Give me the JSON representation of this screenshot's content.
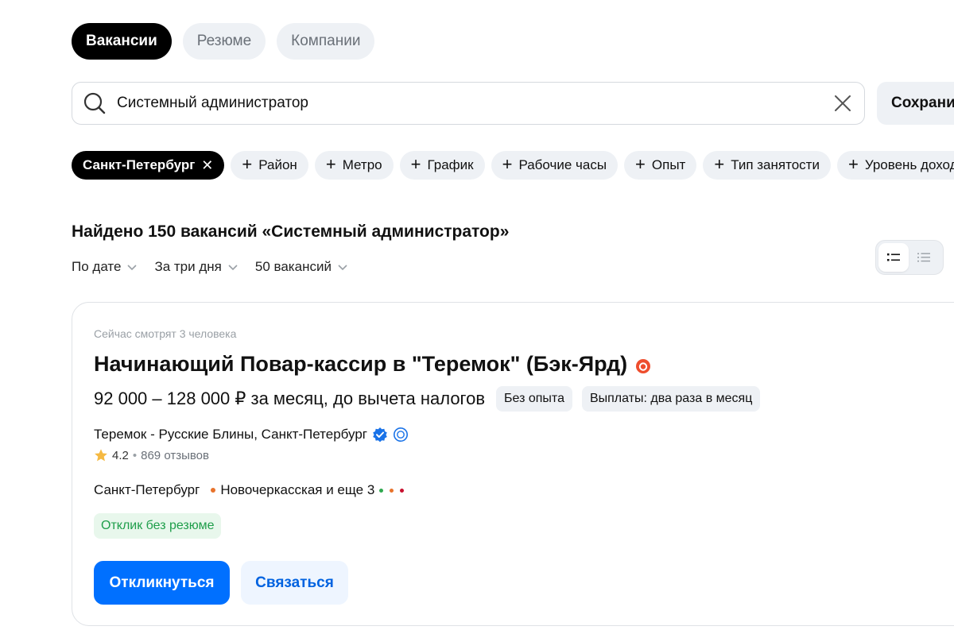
{
  "tabs": [
    {
      "label": "Вакансии",
      "active": true
    },
    {
      "label": "Резюме",
      "active": false
    },
    {
      "label": "Компании",
      "active": false
    }
  ],
  "search": {
    "value": "Системный администратор",
    "save_label": "Сохранить"
  },
  "filters": {
    "city": "Санкт-Петербург",
    "chips": [
      "Район",
      "Метро",
      "График",
      "Рабочие часы",
      "Опыт",
      "Тип занятости",
      "Уровень дохода"
    ]
  },
  "results": {
    "found_text": "Найдено 150 вакансий «Системный администратор»",
    "sorts": [
      "По дате",
      "За три дня",
      "50 вакансий"
    ]
  },
  "vacancy": {
    "watching": "Сейчас смотрят 3 человека",
    "title": "Начинающий Повар-кассир в \"Теремок\" (Бэк-Ярд)",
    "salary": "92 000 – 128 000 ₽ за месяц, до вычета налогов",
    "tags": [
      "Без опыта",
      "Выплаты: два раза в месяц"
    ],
    "company": "Теремок - Русские Блины, Санкт-Петербург",
    "rating": "4.2",
    "reviews": "869 отзывов",
    "city": "Санкт-Петербург",
    "metro": "Новочеркасская и еще 3",
    "no_resume": "Отклик без резюме",
    "apply_label": "Откликнуться",
    "contact_label": "Связаться"
  },
  "colors": {
    "accent": "#0070ff",
    "metro_orange": "#e8732c",
    "metro_green": "#2fa84f",
    "metro_red": "#c8102e",
    "hot_badge": "#ee4d2d"
  }
}
